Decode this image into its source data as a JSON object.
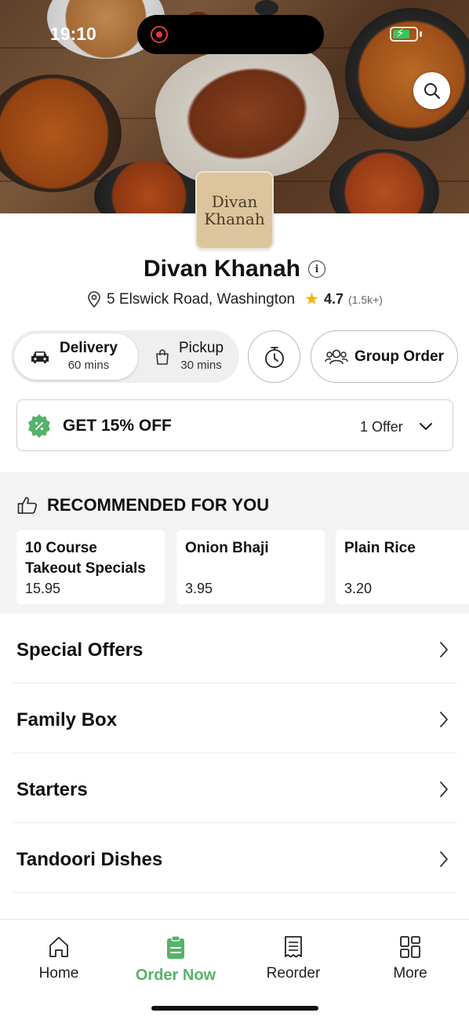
{
  "status_bar": {
    "time": "19:10",
    "battery_level": 0.75
  },
  "restaurant": {
    "logo_text_line1": "Divan",
    "logo_text_line2": "Khanah",
    "name": "Divan Khanah",
    "address": "5 Elswick Road, Washington",
    "rating": "4.7",
    "reviews": "(1.5k+)"
  },
  "modes": {
    "delivery": {
      "label": "Delivery",
      "time": "60 mins",
      "selected": true
    },
    "pickup": {
      "label": "Pickup",
      "time": "30 mins",
      "selected": false
    }
  },
  "group_order_label": "Group Order",
  "offer": {
    "title": "GET 15% OFF",
    "count": "1 Offer"
  },
  "recommended": {
    "heading": "RECOMMENDED FOR YOU",
    "items": [
      {
        "name": "10 Course Takeout Specials",
        "price": "15.95"
      },
      {
        "name": "Onion Bhaji",
        "price": "3.95"
      },
      {
        "name": "Plain Rice",
        "price": "3.20"
      }
    ]
  },
  "categories": [
    "Special Offers",
    "Family Box",
    "Starters",
    "Tandoori Dishes"
  ],
  "bottom_nav": {
    "home": "Home",
    "order_now": "Order Now",
    "reorder": "Reorder",
    "more": "More",
    "active": "order_now"
  },
  "colors": {
    "accent_green": "#56b36a",
    "star": "#f5b301"
  },
  "icons": {
    "search": "search-icon",
    "info": "info-icon",
    "location": "location-pin-icon",
    "car": "car-icon",
    "bag": "bag-icon",
    "timer": "stopwatch-icon",
    "group": "group-icon",
    "offer": "discount-badge-icon",
    "thumbs_up": "thumbs-up-icon"
  }
}
